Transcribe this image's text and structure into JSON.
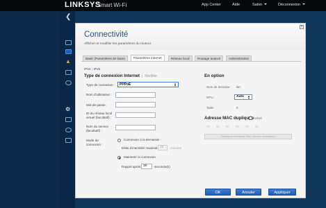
{
  "topbar": {
    "brand": "LINKSYS",
    "brand_sub": "Smart Wi-Fi",
    "nav": {
      "app_center": "App Center",
      "help": "Aide",
      "lounge": "Salon",
      "logout": "Déconnexion"
    }
  },
  "dialog": {
    "title": "Connectivité",
    "subtitle": "Afficher et modifier les paramètres du routeur",
    "tabs": [
      "Basic (Paramètres de base)",
      "Paramètres Internet",
      "Réseau local",
      "Routage avancé",
      "Administration"
    ],
    "subtabs": {
      "ipv4": "IPv4",
      "sep": "|",
      "ipv6": "IPv6"
    },
    "connection": {
      "title": "Type de connexion Internet",
      "sep": "|",
      "edit": "Modifier",
      "type_label": "Type de connexion :",
      "type_value": "PPPoE",
      "username_label": "Nom d'utilisateur :",
      "password_label": "Mot de passe :",
      "service_id_label": "ID du réseau local virtuel (facultatif) :",
      "service_name_label": "Nom du service (facultatif) :",
      "mode_label": "Mode de connexion :",
      "on_demand_label": "Connexion à la demande :",
      "idle_label": "Délai d'inactivité maximal :",
      "idle_value": "15",
      "idle_unit": "minutes",
      "keep_alive_label": "Maintenir la connexion",
      "redial_label": "Rappel après :",
      "redial_value": "30",
      "redial_unit": "seconde(s)"
    },
    "options": {
      "title": "En option",
      "domain_label": "Nom de domaine :",
      "domain_value": "lan",
      "mtu_label": "MTU :",
      "mtu_value": "Auto",
      "size_label": "Taille :",
      "size_value": "0",
      "mac_title": "Adresse MAC dupliquée",
      "mac_active_label": "Activé",
      "mac_parts": [
        "00",
        "00",
        "00",
        "00",
        "00",
        "00"
      ],
      "clone_button": "Dupliquer l'adresse MAC de mon ordinateur"
    },
    "buttons": {
      "ok": "OK",
      "cancel": "Annuler",
      "apply": "Appliquer"
    },
    "close": "×"
  }
}
